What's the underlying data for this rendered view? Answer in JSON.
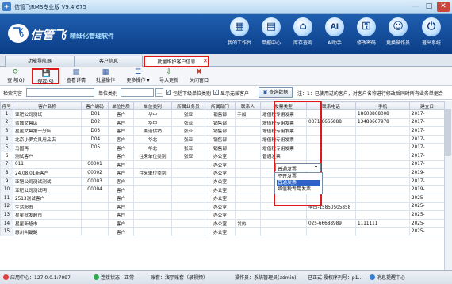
{
  "window": {
    "title": "信管飞RMS专业版 V9.4.675",
    "min": "—",
    "max": "□",
    "close": "✕"
  },
  "banner": {
    "logo_mark": "飞",
    "logo_text": "信管飞",
    "slogan": "精细化管理软件"
  },
  "nav": [
    {
      "label": "我的工作台",
      "icon": "desk-icon",
      "glyph": "▦"
    },
    {
      "label": "单据中心",
      "icon": "document-icon",
      "glyph": "▤"
    },
    {
      "label": "库存查询",
      "icon": "inventory-icon",
      "glyph": "⌂"
    },
    {
      "label": "AI助手",
      "icon": "ai-icon",
      "glyph": "AI"
    },
    {
      "label": "修改密码",
      "icon": "lock-icon",
      "glyph": "⚿"
    },
    {
      "label": "更换操作员",
      "icon": "user-switch-icon",
      "glyph": "☺"
    },
    {
      "label": "退出系统",
      "icon": "power-icon",
      "glyph": "⏻"
    }
  ],
  "tabs": [
    {
      "label": "功能导航器"
    },
    {
      "label": "客户信息"
    },
    {
      "label": "批量维护客户信息"
    }
  ],
  "tab_close": "✕",
  "toolbar": {
    "query": "查询(Q)",
    "save": "保存(S)",
    "details": "查看详情",
    "batch": "批量操作",
    "more": "更多操作",
    "import": "导入更新",
    "close": "关闭窗口"
  },
  "filter": {
    "search_label": "检索内容",
    "unit_label": "单位类别",
    "include_lower": "包括下级单位类别",
    "show_invalid": "显示无效客户",
    "query_button": "查询数据",
    "hint": "注：1：已使用过的客户，对客户名称进行修改后同时所有业务单据会"
  },
  "grid": {
    "columns": [
      "序号",
      "客户名称",
      "客户编码",
      "单位性质",
      "单位类别",
      "所属业务员",
      "所属部门",
      "联系人",
      "发票类型",
      "联系电话",
      "手机",
      "建立日"
    ],
    "rows": [
      [
        "1",
        "亚钯公司测试",
        "ID01",
        "客户",
        "华中",
        "张亚",
        "销售部",
        "手加",
        "增值税专用发票",
        "",
        "18608808008",
        "2017-"
      ],
      [
        "2",
        "蓝城文具店",
        "ID02",
        "客户",
        "华中",
        "张亚",
        "销售部",
        "",
        "增值税专用发票",
        "0371-6666888",
        "13488667978",
        "2017-"
      ],
      [
        "3",
        "星星文具第一分店",
        "ID03",
        "客户",
        "渠道供销",
        "张亚",
        "销售部",
        "",
        "增值税专用发票",
        "",
        "",
        "2017-"
      ],
      [
        "4",
        "北京小罗文具用品店",
        "ID04",
        "客户",
        "华北",
        "张亚",
        "销售部",
        "",
        "增值税专用发票",
        "",
        "",
        "2017-"
      ],
      [
        "5",
        "马国再",
        "ID05",
        "客户",
        "华北",
        "张亚",
        "销售部",
        "",
        "增值税专用发票",
        "",
        "",
        "2017-"
      ],
      [
        "6",
        "测试客户",
        "",
        "客户",
        "往来单位类别",
        "张亚",
        "办公室",
        "",
        "普通发票",
        "",
        "",
        "2017-"
      ],
      [
        "7",
        "011",
        "C0001",
        "客户",
        "",
        "",
        "办公室",
        "",
        "",
        "",
        "",
        "2017-"
      ],
      [
        "8",
        "24.08.01新客户",
        "C0002",
        "客户",
        "往来单位类别",
        "",
        "办公室",
        "",
        "",
        "",
        "",
        "2019-"
      ],
      [
        "9",
        "亚钯公司测试测试",
        "C0003",
        "客户",
        "",
        "",
        "办公室",
        "",
        "",
        "",
        "",
        "2017-"
      ],
      [
        "10",
        "亚钯公司测试明",
        "C0004",
        "客户",
        "",
        "",
        "办公室",
        "",
        "",
        "",
        "",
        "2019-"
      ],
      [
        "11",
        "2513测试客户",
        "",
        "客户",
        "",
        "",
        "办公室",
        "",
        "",
        "",
        "",
        "2025-"
      ],
      [
        "12",
        "生活超市",
        "",
        "客户",
        "",
        "",
        "办公室",
        "",
        "",
        "李白-15850505858",
        "",
        "2025-"
      ],
      [
        "13",
        "星星批发超市",
        "",
        "客户",
        "",
        "",
        "办公室",
        "",
        "",
        "",
        "",
        "2025-"
      ],
      [
        "14",
        "星星新超市",
        "",
        "客户",
        "",
        "",
        "办公室",
        "发热",
        "",
        "025-66688989",
        "1111111",
        "2025-"
      ],
      [
        "15",
        "惠州叫锄鲍",
        "",
        "客户",
        "",
        "",
        "办公室",
        "",
        "",
        "",
        "",
        "2025-"
      ]
    ]
  },
  "dropdown": {
    "current": "普通发票",
    "arrow": "▾",
    "options": [
      "不开发票",
      "普通发票",
      "增值税专用发票"
    ],
    "selected_index": 1
  },
  "status": {
    "app_center": "应用中心：127.0.0.1:7097",
    "connection": "连接状态：正常",
    "account": "账套：演示账套（录视频）",
    "operator": "操作员：系统管理员(admin)",
    "version": "已正式 授权序列号：p1...",
    "message": "消息提醒中心"
  },
  "colors": {
    "accent": "#1f5fb0",
    "highlight": "#e01818",
    "selection": "#2d63c8"
  }
}
